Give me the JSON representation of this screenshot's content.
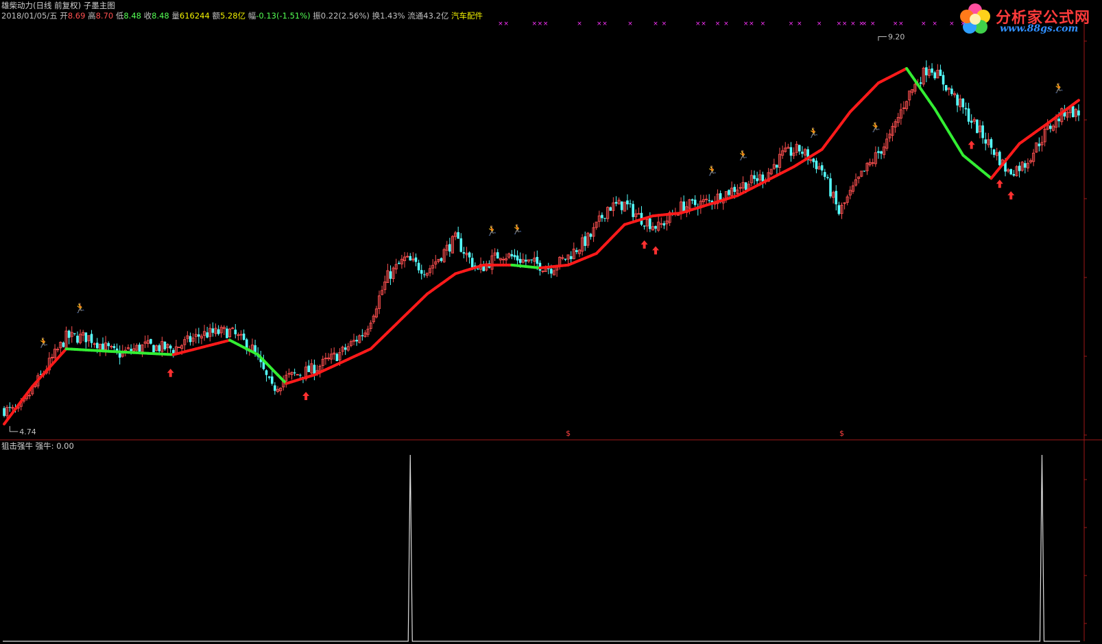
{
  "header": {
    "title": "雄柴动力(日线 前复权) 子墨主图",
    "date": "2018/01/05/五",
    "open_label": "开",
    "open": "8.69",
    "high_label": "高",
    "high": "8.70",
    "low_label": "低",
    "low": "8.48",
    "close_label": "收",
    "close": "8.48",
    "vol_label": "量",
    "vol": "616244",
    "amt_label": "额",
    "amt": "5.28亿",
    "chg_label": "幅",
    "chg": "-0.13(-1.51%)",
    "amp_label": "振",
    "amp": "0.22(2.56%)",
    "turn_label": "换",
    "turn": "1.43%",
    "float_label": "流通",
    "float": "43.2亿",
    "sector": "汽车配件"
  },
  "logo": {
    "name": "分析家公式网",
    "url": "www.88gs.com"
  },
  "colors": {
    "up": "#ff5050",
    "down": "#54ffff",
    "ma_up": "#ff1a1a",
    "ma_down": "#33ee33",
    "runner": "#ffa95a",
    "cross": "#ff33ff",
    "arrow": "#ff3030"
  },
  "chart_data": [
    {
      "type": "candlestick",
      "name": "main",
      "annotations": {
        "max_price": "9.20",
        "min_price": "4.74"
      },
      "anchors": [
        [
          0,
          5.0
        ],
        [
          5,
          4.95
        ],
        [
          12,
          5.5
        ],
        [
          22,
          6.25
        ],
        [
          30,
          6.25
        ],
        [
          40,
          5.95
        ],
        [
          50,
          6.1
        ],
        [
          60,
          6.05
        ],
        [
          70,
          6.3
        ],
        [
          80,
          6.35
        ],
        [
          88,
          6.05
        ],
        [
          95,
          5.35
        ],
        [
          100,
          5.55
        ],
        [
          110,
          5.7
        ],
        [
          120,
          6.0
        ],
        [
          128,
          6.35
        ],
        [
          136,
          7.3
        ],
        [
          142,
          7.6
        ],
        [
          150,
          7.4
        ],
        [
          160,
          7.95
        ],
        [
          168,
          7.4
        ],
        [
          176,
          7.7
        ],
        [
          186,
          7.55
        ],
        [
          194,
          7.45
        ],
        [
          200,
          7.65
        ],
        [
          208,
          8.0
        ],
        [
          214,
          8.5
        ],
        [
          220,
          8.55
        ],
        [
          226,
          8.3
        ],
        [
          232,
          8.15
        ],
        [
          240,
          8.5
        ],
        [
          250,
          8.6
        ],
        [
          260,
          8.85
        ],
        [
          270,
          9.05
        ],
        [
          276,
          9.4
        ],
        [
          282,
          9.5
        ],
        [
          290,
          9.15
        ],
        [
          296,
          8.4
        ],
        [
          304,
          9.05
        ],
        [
          314,
          9.7
        ],
        [
          320,
          10.4
        ],
        [
          328,
          10.95
        ],
        [
          334,
          10.6
        ],
        [
          340,
          10.2
        ],
        [
          346,
          9.8
        ],
        [
          352,
          9.4
        ],
        [
          356,
          9.1
        ],
        [
          362,
          9.25
        ],
        [
          370,
          9.85
        ],
        [
          377,
          10.2
        ],
        [
          381,
          10.1
        ]
      ],
      "ma_anchors": [
        [
          0,
          4.75
        ],
        [
          10,
          5.4
        ],
        [
          22,
          6.05
        ],
        [
          40,
          6.0
        ],
        [
          60,
          5.95
        ],
        [
          80,
          6.2
        ],
        [
          90,
          5.95
        ],
        [
          100,
          5.45
        ],
        [
          110,
          5.6
        ],
        [
          130,
          6.05
        ],
        [
          150,
          7.0
        ],
        [
          160,
          7.35
        ],
        [
          170,
          7.5
        ],
        [
          180,
          7.5
        ],
        [
          190,
          7.45
        ],
        [
          200,
          7.5
        ],
        [
          210,
          7.7
        ],
        [
          220,
          8.2
        ],
        [
          230,
          8.35
        ],
        [
          240,
          8.4
        ],
        [
          260,
          8.7
        ],
        [
          270,
          8.95
        ],
        [
          280,
          9.2
        ],
        [
          290,
          9.5
        ],
        [
          300,
          10.15
        ],
        [
          310,
          10.65
        ],
        [
          320,
          10.9
        ],
        [
          330,
          10.2
        ],
        [
          340,
          9.4
        ],
        [
          350,
          9.0
        ],
        [
          360,
          9.6
        ],
        [
          370,
          9.95
        ],
        [
          381,
          10.35
        ]
      ],
      "signals": {
        "runner": [
          27,
          14,
          173,
          182,
          251,
          262,
          287,
          309,
          374
        ],
        "arrow": [
          107,
          59,
          227,
          231,
          343,
          353,
          357
        ],
        "dollar": [
          200,
          297
        ],
        "cross_x": [
          176,
          178,
          188,
          190,
          192,
          204,
          211,
          213,
          222,
          231,
          234,
          246,
          248,
          253,
          256,
          263,
          265,
          269,
          279,
          282,
          289,
          296,
          298,
          301,
          304,
          305,
          308,
          316,
          318,
          326,
          330,
          336,
          340
        ]
      },
      "ylim": [
        4.5,
        11.8
      ],
      "n_bars": 382
    },
    {
      "type": "line",
      "name": "sub",
      "title": "狙击强牛",
      "series_label": "强牛:",
      "series_value": "0.00",
      "spikes_at": [
        144,
        368
      ],
      "ylim": [
        0,
        1
      ]
    }
  ]
}
